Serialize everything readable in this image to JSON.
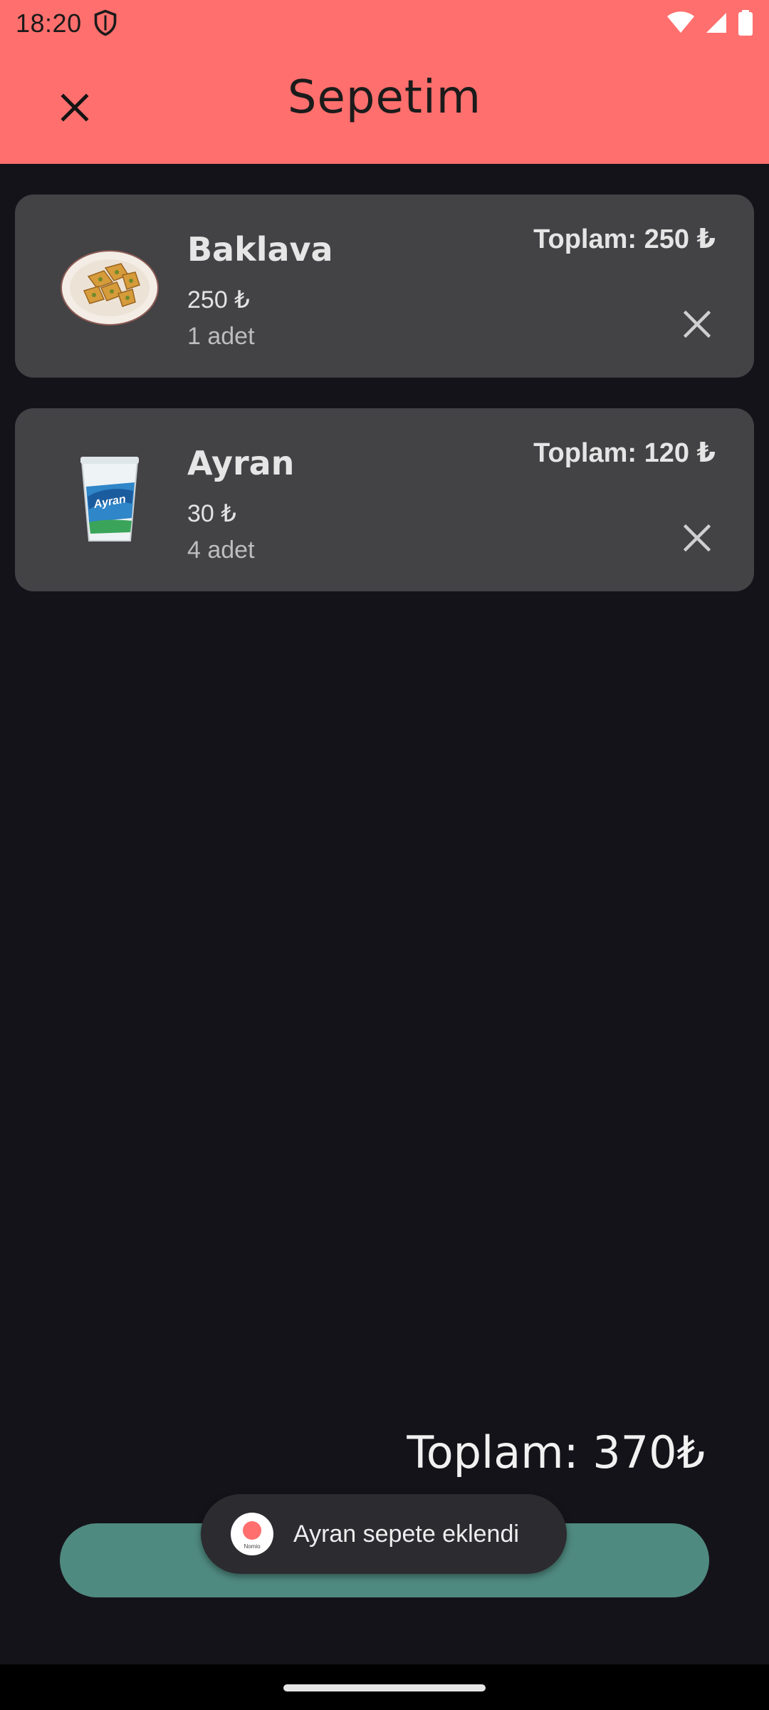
{
  "status_bar": {
    "time": "18:20"
  },
  "app_bar": {
    "title": "Sepetim"
  },
  "cart_items": [
    {
      "name": "Baklava",
      "price": "250 ₺",
      "quantity": "1 adet",
      "total": "Toplam: 250 ₺"
    },
    {
      "name": "Ayran",
      "price": "30 ₺",
      "quantity": "4 adet",
      "total": "Toplam: 120 ₺"
    }
  ],
  "summary": {
    "grand_total": "Toplam: 370₺"
  },
  "toast": {
    "message": "Ayran sepete eklendi",
    "logo_text": "Nomio"
  },
  "colors": {
    "header": "#ff6f6d",
    "background": "#15131a",
    "card": "#434245",
    "checkout_button": "#4f8a80"
  }
}
